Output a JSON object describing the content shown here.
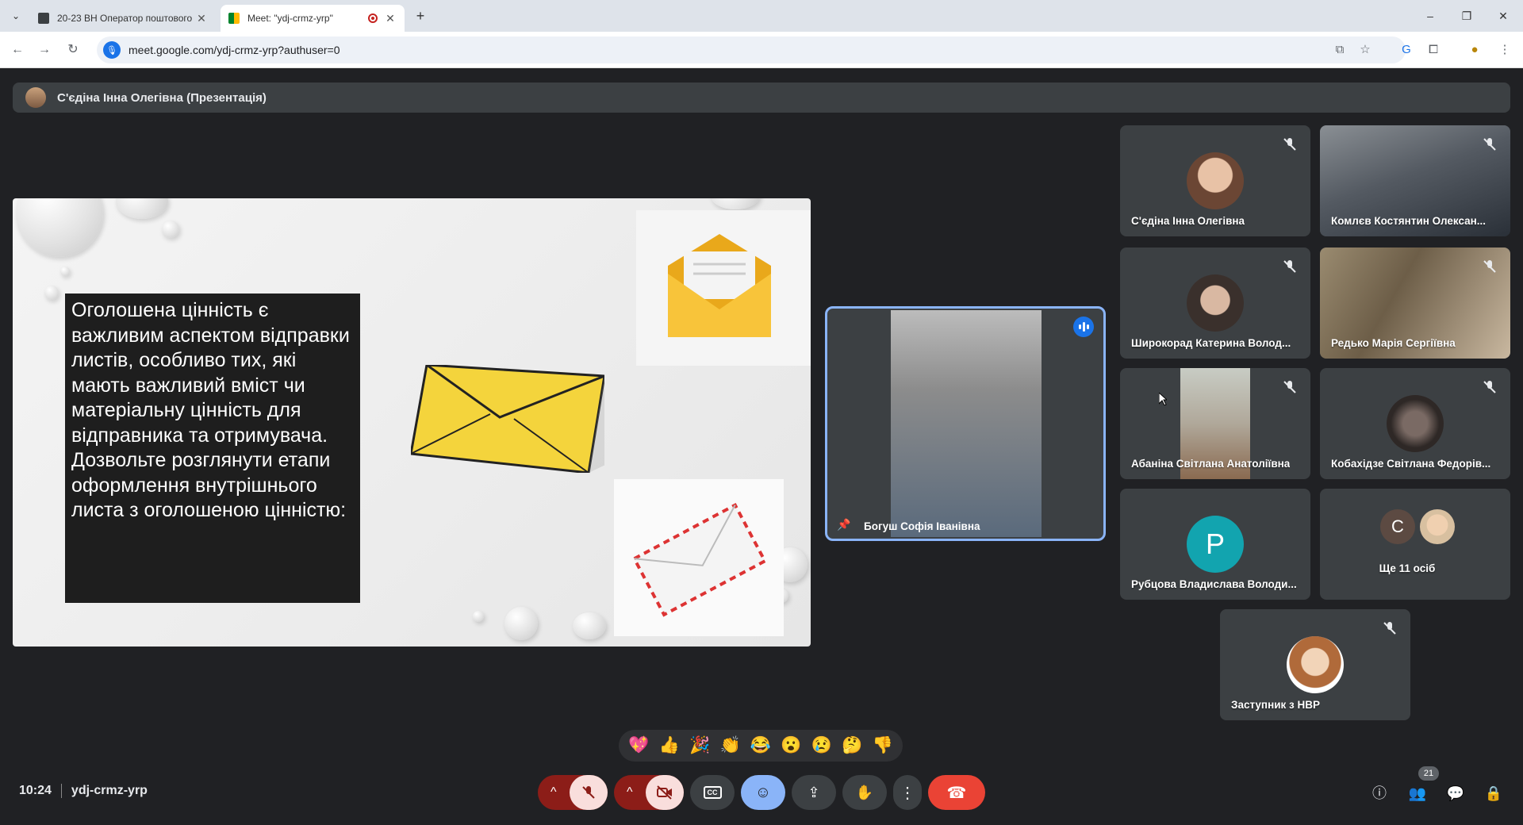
{
  "browser": {
    "tabs": [
      {
        "title": "20-23 ВН Оператор поштового"
      },
      {
        "title": "Meet: \"ydj-crmz-yrp\""
      }
    ],
    "url": "meet.google.com/ydj-crmz-yrp?authuser=0",
    "window_controls": [
      "minimize-icon",
      "restore-icon",
      "close-icon"
    ]
  },
  "meet": {
    "presenter_label": "С'єдіна Інна Олегівна (Презентація)",
    "slide": {
      "text": "Оголошена цінність є важливим аспектом відправки листів, особливо тих, які мають важливий вміст чи матеріальну цінність для відправника та отримувача. Дозвольте розглянути етапи оформлення внутрішнього листа з оголошеною цінністю:"
    },
    "active_speaker": {
      "name": "Богуш Софія Іванівна"
    },
    "participants": [
      {
        "name": "С'єдіна Інна Олегівна"
      },
      {
        "name": "Комлєв Костянтин Олексан..."
      },
      {
        "name": "Широкорад Катерина Волод..."
      },
      {
        "name": "Редько Марія Сергіївна"
      },
      {
        "name": "Абаніна Світлана Анатоліївна"
      },
      {
        "name": "Кобахідзе Світлана Федорів..."
      },
      {
        "name": "Рубцова Владислава Володи...",
        "initial": "P"
      },
      {
        "name": "Ще 11 осіб",
        "initial": "C"
      },
      {
        "name": "Заступник з НВР"
      }
    ],
    "reactions": [
      "💖",
      "👍",
      "🎉",
      "👏",
      "😂",
      "😮",
      "😢",
      "🤔",
      "👎"
    ],
    "time": "10:24",
    "meeting_code": "ydj-crmz-yrp",
    "people_count": "21",
    "colors": {
      "accent": "#8ab4f8",
      "end_call": "#ea4335",
      "p_avatar": "#12a4af"
    }
  }
}
